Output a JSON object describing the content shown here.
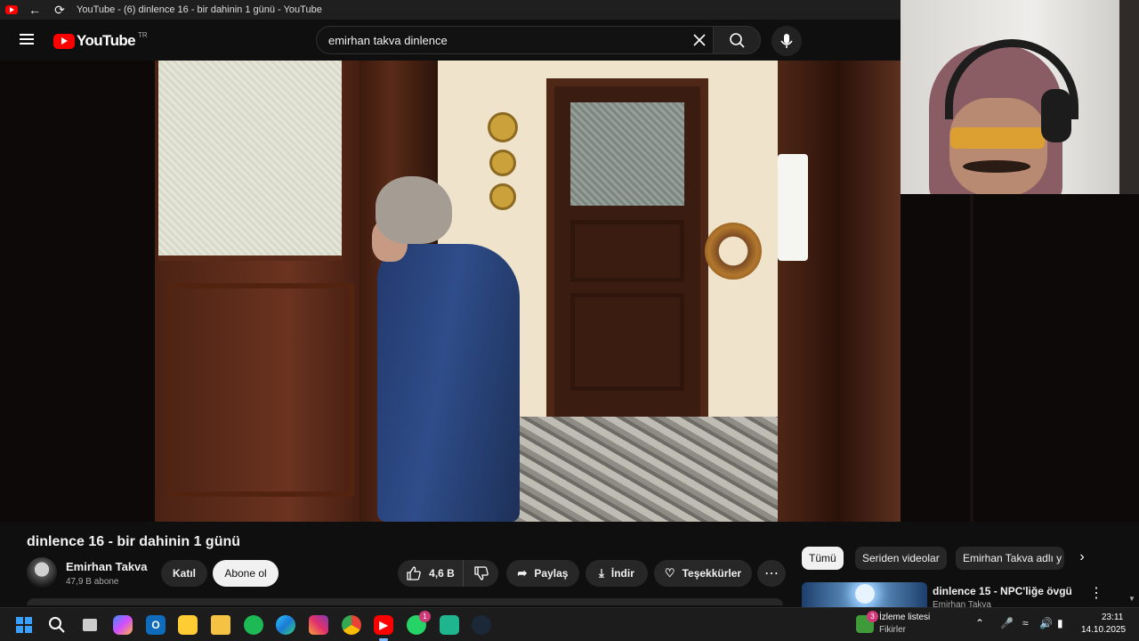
{
  "browser": {
    "tab_title": "YouTube - (6) dinlence 16 - bir dahinin 1 günü - YouTube",
    "back_icon": "back-arrow-icon",
    "reload_icon": "reload-icon"
  },
  "header": {
    "logo_text": "YouTube",
    "region": "TR",
    "search_value": "emirhan takva dinlence"
  },
  "video": {
    "title": "dinlence 16 - bir dahinin 1 günü",
    "channel_name": "Emirhan Takva",
    "subscribers": "47,9 B abone",
    "join_label": "Katıl",
    "subscribe_label": "Abone ol",
    "like_count": "4,6 B",
    "share_label": "Paylaş",
    "download_label": "İndir",
    "thanks_label": "Teşekkürler"
  },
  "sidebar": {
    "chips": [
      "Tümü",
      "Seriden videolar",
      "Emirhan Takva adlı y"
    ],
    "reco_title": "dinlence 15 - NPC'liğe övgü",
    "reco_channel": "Emirhan Takva"
  },
  "taskbar": {
    "apps": [
      "start-icon",
      "search-icon",
      "task-view-icon",
      "copilot-icon",
      "outlook-icon",
      "sticky-notes-icon",
      "file-explorer-icon",
      "spotify-icon",
      "edge-icon",
      "instagram-icon",
      "chrome-icon",
      "youtube-icon",
      "whatsapp-icon",
      "chat-app-icon",
      "steam-icon"
    ],
    "whatsapp_badge": "1",
    "widget_badge": "3",
    "widget_title": "İzleme listesi",
    "widget_subtitle": "Fikirler",
    "time": "23:11",
    "date": "14.10.2025"
  },
  "colors": {
    "accent_red": "#ff0000",
    "background": "#0f0f0f",
    "chip_bg": "#272727"
  }
}
